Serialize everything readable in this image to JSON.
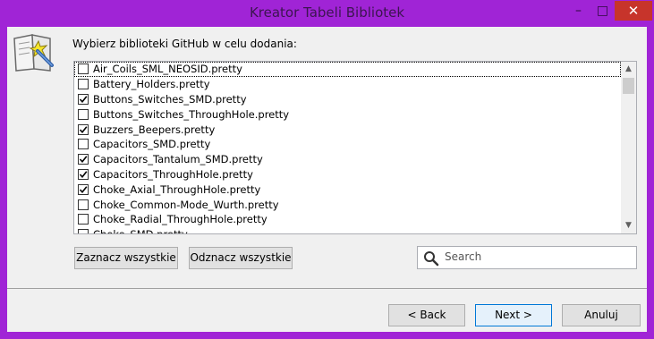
{
  "window": {
    "title": "Kreator Tabeli Bibliotek",
    "minimize": "–",
    "maximize": "□",
    "close": "✕"
  },
  "prompt": "Wybierz biblioteki GitHub w celu dodania:",
  "libraries": [
    {
      "name": "Air_Coils_SML_NEOSID.pretty",
      "checked": false,
      "focused": true
    },
    {
      "name": "Battery_Holders.pretty",
      "checked": false
    },
    {
      "name": "Buttons_Switches_SMD.pretty",
      "checked": true
    },
    {
      "name": "Buttons_Switches_ThroughHole.pretty",
      "checked": false
    },
    {
      "name": "Buzzers_Beepers.pretty",
      "checked": true
    },
    {
      "name": "Capacitors_SMD.pretty",
      "checked": false
    },
    {
      "name": "Capacitors_Tantalum_SMD.pretty",
      "checked": true
    },
    {
      "name": "Capacitors_ThroughHole.pretty",
      "checked": true
    },
    {
      "name": "Choke_Axial_ThroughHole.pretty",
      "checked": true
    },
    {
      "name": "Choke_Common-Mode_Wurth.pretty",
      "checked": false
    },
    {
      "name": "Choke_Radial_ThroughHole.pretty",
      "checked": false
    },
    {
      "name": "Choke_SMD.pretty",
      "checked": false
    }
  ],
  "buttons": {
    "select_all": "Zaznacz wszystkie",
    "deselect_all": "Odznacz wszystkie",
    "back": "< Back",
    "next": "Next >",
    "cancel": "Anuluj"
  },
  "search": {
    "placeholder": "Search"
  },
  "icons": {
    "app": "library-wizard-icon",
    "search": "search-icon"
  }
}
